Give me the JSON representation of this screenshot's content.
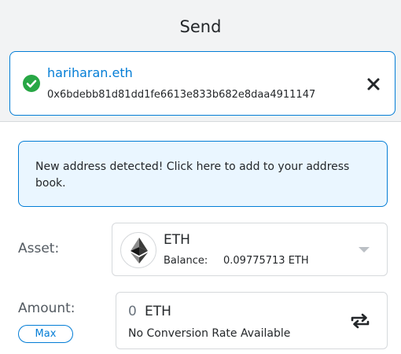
{
  "header": {
    "title": "Send"
  },
  "recipient": {
    "ens_name": "hariharan.eth",
    "address": "0x6bdebb81d81dd1fe6613e833b682e8daa4911147",
    "verified_icon": "check-circle-icon",
    "close_icon": "close-icon"
  },
  "notice": {
    "text": "New address detected! Click here to add to your address book."
  },
  "asset": {
    "label": "Asset:",
    "symbol": "ETH",
    "icon": "ethereum-icon",
    "balance_label": "Balance:",
    "balance_value": "0.09775713 ETH",
    "dropdown_icon": "caret-down-icon"
  },
  "amount": {
    "label": "Amount:",
    "max_label": "Max",
    "value": "0",
    "unit": "ETH",
    "conversion": "No Conversion Rate Available",
    "swap_icon": "swap-icon"
  },
  "colors": {
    "accent": "#037dd6",
    "success": "#28a745",
    "notice_bg": "#eaf6ff",
    "header_bg": "#f2f3f4"
  }
}
